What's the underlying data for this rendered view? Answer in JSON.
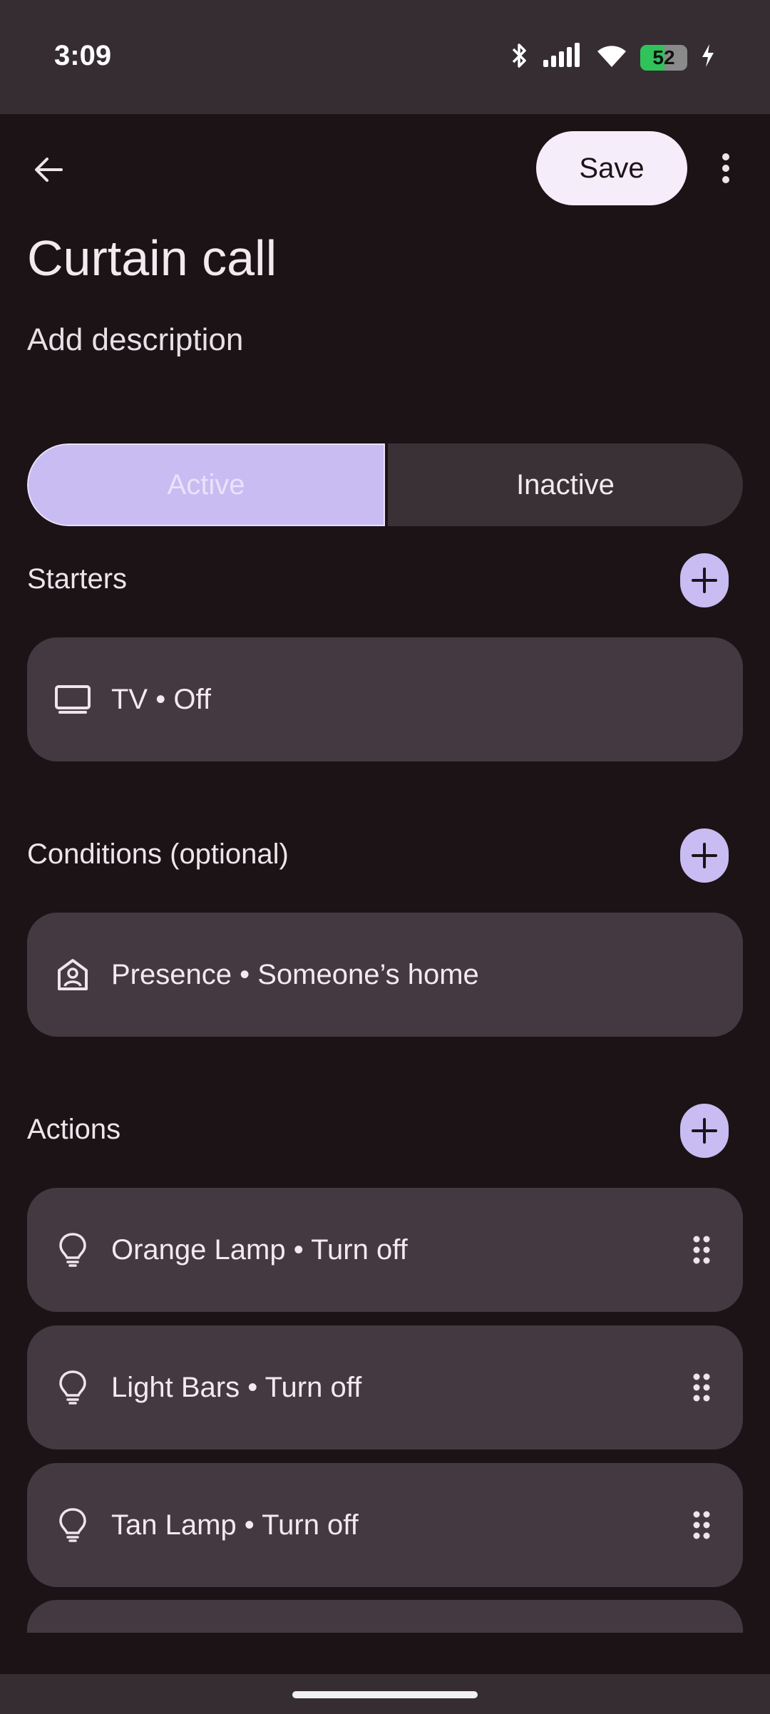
{
  "status_bar": {
    "time": "3:09",
    "battery_level": "52"
  },
  "toolbar": {
    "save_label": "Save"
  },
  "routine": {
    "title": "Curtain call",
    "description": "Add description"
  },
  "state_toggle": {
    "active_label": "Active",
    "inactive_label": "Inactive",
    "selected": "Active"
  },
  "starters": {
    "label": "Starters",
    "items": [
      {
        "icon": "tv-icon",
        "text": "TV • Off"
      }
    ]
  },
  "conditions": {
    "label": "Conditions (optional)",
    "items": [
      {
        "icon": "presence-home-icon",
        "text": "Presence • Someone’s home"
      }
    ]
  },
  "actions": {
    "label": "Actions",
    "items": [
      {
        "icon": "lightbulb-icon",
        "text": "Orange Lamp • Turn off"
      },
      {
        "icon": "lightbulb-icon",
        "text": "Light Bars • Turn off"
      },
      {
        "icon": "lightbulb-icon",
        "text": "Tan Lamp • Turn off"
      }
    ]
  },
  "colors": {
    "accent": "#c8bcf2",
    "card": "#443940",
    "background": "#1c1317",
    "status_bar": "#352d32"
  }
}
